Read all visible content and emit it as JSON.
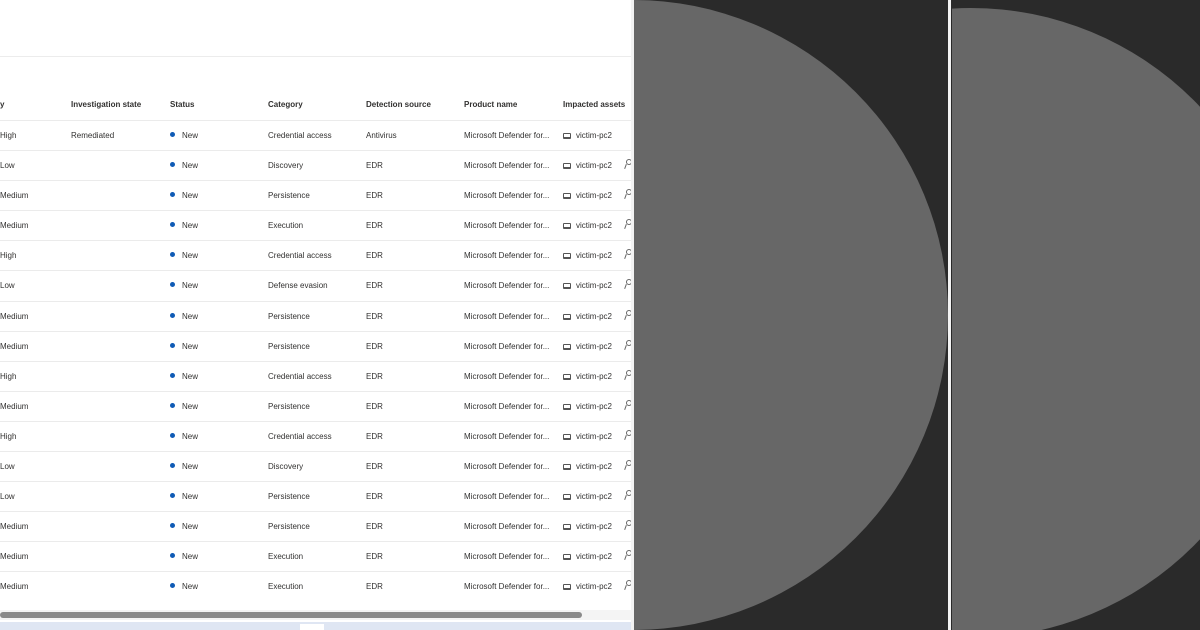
{
  "columns": [
    "y",
    "Investigation state",
    "Status",
    "Category",
    "Detection source",
    "Product name",
    "Impacted assets"
  ],
  "rows": [
    {
      "severity": "High",
      "investigation": "Remediated",
      "status": "New",
      "category": "Credential access",
      "source": "Antivirus",
      "product": "Microsoft Defender for...",
      "asset": "victim-pc2"
    },
    {
      "severity": "Low",
      "investigation": "",
      "status": "New",
      "category": "Discovery",
      "source": "EDR",
      "product": "Microsoft Defender for...",
      "asset": "victim-pc2"
    },
    {
      "severity": "Medium",
      "investigation": "",
      "status": "New",
      "category": "Persistence",
      "source": "EDR",
      "product": "Microsoft Defender for...",
      "asset": "victim-pc2"
    },
    {
      "severity": "Medium",
      "investigation": "",
      "status": "New",
      "category": "Execution",
      "source": "EDR",
      "product": "Microsoft Defender for...",
      "asset": "victim-pc2"
    },
    {
      "severity": "High",
      "investigation": "",
      "status": "New",
      "category": "Credential access",
      "source": "EDR",
      "product": "Microsoft Defender for...",
      "asset": "victim-pc2"
    },
    {
      "severity": "Low",
      "investigation": "",
      "status": "New",
      "category": "Defense evasion",
      "source": "EDR",
      "product": "Microsoft Defender for...",
      "asset": "victim-pc2"
    },
    {
      "severity": "Medium",
      "investigation": "",
      "status": "New",
      "category": "Persistence",
      "source": "EDR",
      "product": "Microsoft Defender for...",
      "asset": "victim-pc2"
    },
    {
      "severity": "Medium",
      "investigation": "",
      "status": "New",
      "category": "Persistence",
      "source": "EDR",
      "product": "Microsoft Defender for...",
      "asset": "victim-pc2"
    },
    {
      "severity": "High",
      "investigation": "",
      "status": "New",
      "category": "Credential access",
      "source": "EDR",
      "product": "Microsoft Defender for...",
      "asset": "victim-pc2"
    },
    {
      "severity": "Medium",
      "investigation": "",
      "status": "New",
      "category": "Persistence",
      "source": "EDR",
      "product": "Microsoft Defender for...",
      "asset": "victim-pc2"
    },
    {
      "severity": "High",
      "investigation": "",
      "status": "New",
      "category": "Credential access",
      "source": "EDR",
      "product": "Microsoft Defender for...",
      "asset": "victim-pc2"
    },
    {
      "severity": "Low",
      "investigation": "",
      "status": "New",
      "category": "Discovery",
      "source": "EDR",
      "product": "Microsoft Defender for...",
      "asset": "victim-pc2"
    },
    {
      "severity": "Low",
      "investigation": "",
      "status": "New",
      "category": "Persistence",
      "source": "EDR",
      "product": "Microsoft Defender for...",
      "asset": "victim-pc2"
    },
    {
      "severity": "Medium",
      "investigation": "",
      "status": "New",
      "category": "Persistence",
      "source": "EDR",
      "product": "Microsoft Defender for...",
      "asset": "victim-pc2"
    },
    {
      "severity": "Medium",
      "investigation": "",
      "status": "New",
      "category": "Execution",
      "source": "EDR",
      "product": "Microsoft Defender for...",
      "asset": "victim-pc2"
    },
    {
      "severity": "Medium",
      "investigation": "",
      "status": "New",
      "category": "Execution",
      "source": "EDR",
      "product": "Microsoft Defender for...",
      "asset": "victim-pc2"
    }
  ],
  "colors": {
    "status_dot": "#0f5bb5",
    "panel_dark": "#2a2a2a",
    "circle_fill": "#676767"
  },
  "icons": {
    "asset": "laptop-icon",
    "trailing": "search-person-icon"
  }
}
